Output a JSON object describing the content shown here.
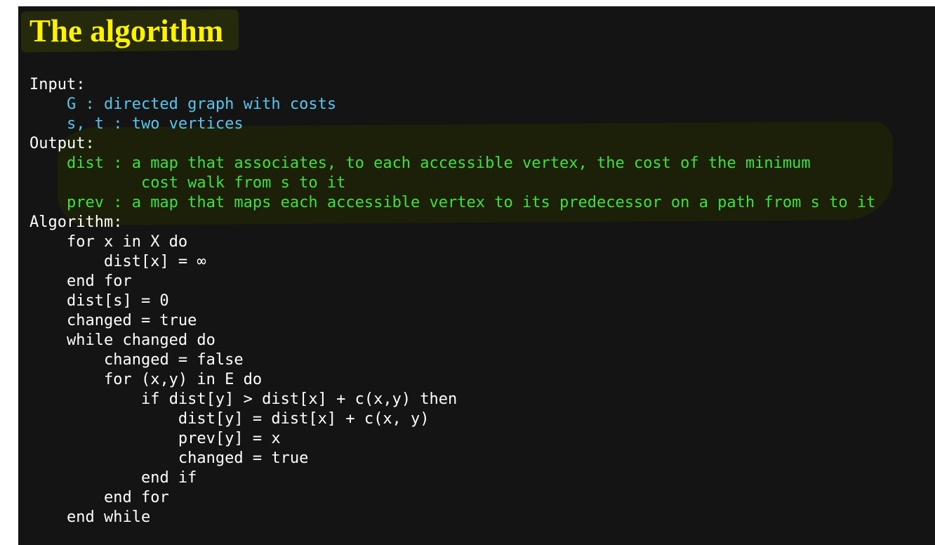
{
  "title": "The algorithm",
  "lines": [
    {
      "text": "Input:",
      "indent": 0,
      "color": "white"
    },
    {
      "text": "G : directed graph with costs",
      "indent": 4,
      "color": "blue"
    },
    {
      "text": "s, t : two vertices",
      "indent": 4,
      "color": "blue"
    },
    {
      "text": "Output:",
      "indent": 0,
      "color": "white"
    },
    {
      "text": "dist : a map that associates, to each accessible vertex, the cost of the minimum",
      "indent": 4,
      "color": "green"
    },
    {
      "text": "cost walk from s to it",
      "indent": 12,
      "color": "green"
    },
    {
      "text": "prev : a map that maps each accessible vertex to its predecessor on a path from s to it",
      "indent": 4,
      "color": "green"
    },
    {
      "text": "Algorithm:",
      "indent": 0,
      "color": "white"
    },
    {
      "text": "for x in X do",
      "indent": 4,
      "color": "white"
    },
    {
      "text": "dist[x] = ∞",
      "indent": 8,
      "color": "white"
    },
    {
      "text": "end for",
      "indent": 4,
      "color": "white"
    },
    {
      "text": "dist[s] = 0",
      "indent": 4,
      "color": "white"
    },
    {
      "text": "changed = true",
      "indent": 4,
      "color": "white"
    },
    {
      "text": "while changed do",
      "indent": 4,
      "color": "white"
    },
    {
      "text": "changed = false",
      "indent": 8,
      "color": "white"
    },
    {
      "text": "for (x,y) in E do",
      "indent": 8,
      "color": "white"
    },
    {
      "text": "if dist[y] > dist[x] + c(x,y) then",
      "indent": 12,
      "color": "white"
    },
    {
      "text": "dist[y] = dist[x] + c(x, y)",
      "indent": 16,
      "color": "white"
    },
    {
      "text": "prev[y] = x",
      "indent": 16,
      "color": "white"
    },
    {
      "text": "changed = true",
      "indent": 16,
      "color": "white"
    },
    {
      "text": "end if",
      "indent": 12,
      "color": "white"
    },
    {
      "text": "end for",
      "indent": 8,
      "color": "white"
    },
    {
      "text": "end while",
      "indent": 4,
      "color": "white"
    }
  ],
  "colors": {
    "background": "#141414",
    "title": "#fff200",
    "title_highlight": "#262a0c",
    "output_highlight": "#1c2008",
    "white": "#ffffff",
    "blue": "#56c6f0",
    "green": "#3ee03e"
  }
}
